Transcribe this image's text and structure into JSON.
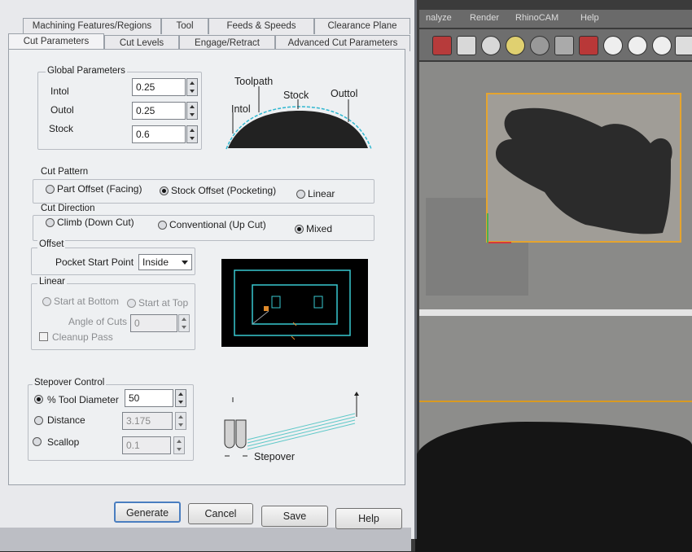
{
  "menubar": [
    "nalyze",
    "Render",
    "RhinoCAM",
    "Help"
  ],
  "toolbar_icons": [
    "layers-icon",
    "box-icon",
    "pipe-icon",
    "lightbulb-icon",
    "lock-icon",
    "cube-icon",
    "sphere-icon",
    "circle-icon",
    "circle-icon",
    "gear-icon"
  ],
  "tabs_row1": [
    "Machining Features/Regions",
    "Tool",
    "Feeds & Speeds",
    "Clearance Plane"
  ],
  "tabs_row2": [
    "Cut Parameters",
    "Cut Levels",
    "Engage/Retract",
    "Advanced Cut Parameters"
  ],
  "global": {
    "title": "Global Parameters",
    "intol_label": "Intol",
    "intol_value": "0.25",
    "outol_label": "Outol",
    "outol_value": "0.25",
    "stock_label": "Stock",
    "stock_value": "0.6"
  },
  "tol_diagram": {
    "toolpath": "Toolpath",
    "stock": "Stock",
    "outtol": "Outtol",
    "intol": "Intol"
  },
  "cut_pattern": {
    "title": "Cut Pattern",
    "options": [
      "Part Offset (Facing)",
      "Stock Offset (Pocketing)",
      "Linear"
    ],
    "selected_index": 1
  },
  "cut_direction": {
    "title": "Cut Direction",
    "options": [
      "Climb (Down Cut)",
      "Conventional (Up Cut)",
      "Mixed"
    ],
    "selected_index": 2
  },
  "offset": {
    "title": "Offset",
    "pocket_label": "Pocket Start Point",
    "pocket_value": "Inside"
  },
  "linear": {
    "title": "Linear",
    "start_bottom": "Start at Bottom",
    "start_top": "Start at Top",
    "angle_label": "Angle of Cuts",
    "angle_value": "0",
    "cleanup": "Cleanup Pass"
  },
  "stepover": {
    "title": "Stepover Control",
    "tool_diameter_label": "% Tool Diameter",
    "tool_diameter_value": "50",
    "distance_label": "Distance",
    "distance_value": "3.175",
    "scallop_label": "Scallop",
    "scallop_value": "0.1",
    "selected_index": 0,
    "diagram_label": "Stepover"
  },
  "buttons": {
    "generate": "Generate",
    "cancel": "Cancel",
    "save": "Save",
    "help": "Help"
  },
  "colors": {
    "accent_blue": "#4a7ec0",
    "selection_orange": "#e5a42e",
    "preview_cyan": "#39c8d0"
  }
}
